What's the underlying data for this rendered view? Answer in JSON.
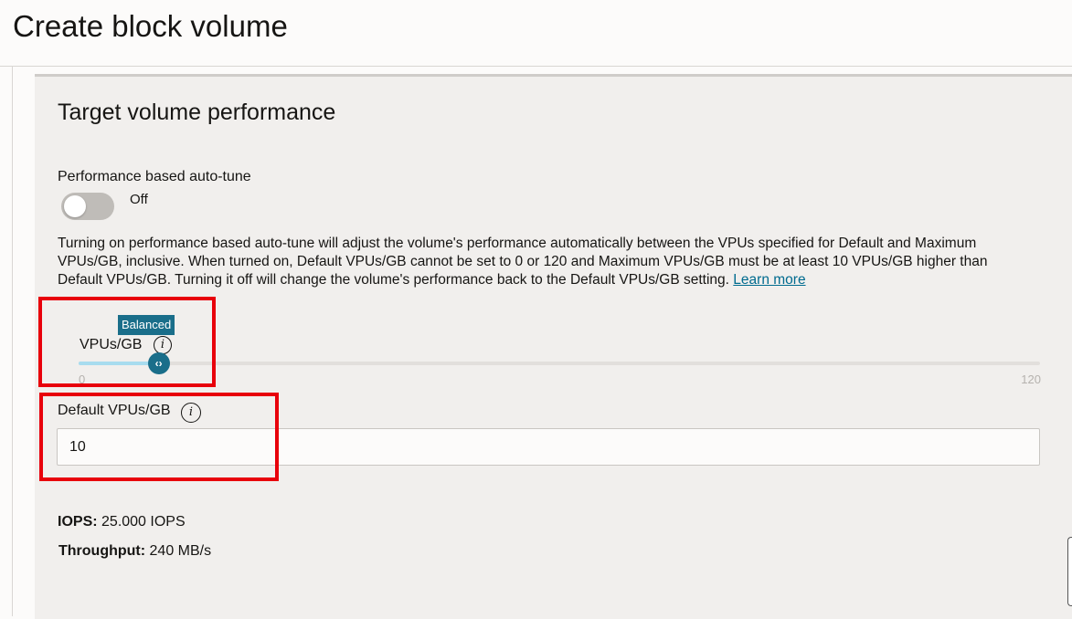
{
  "header": {
    "title": "Create block volume"
  },
  "section": {
    "title": "Target volume performance",
    "autotune": {
      "label": "Performance based auto-tune",
      "state": "Off",
      "enabled": false
    },
    "description": "Turning on performance based auto-tune will adjust the volume's performance automatically between the VPUs specified for Default and Maximum VPUs/GB, inclusive. When turned on, Default VPUs/GB cannot be set to 0 or 120 and Maximum VPUs/GB must be at least 10 VPUs/GB higher than Default VPUs/GB. Turning it off will change the volume's performance back to the Default VPUs/GB setting.",
    "learn_more": "Learn more",
    "slider": {
      "badge": "Balanced",
      "label": "VPUs/GB",
      "min_label": "0",
      "max_label": "120",
      "min": 0,
      "max": 120,
      "value": 10,
      "handle_glyph": "‹›"
    },
    "default_vpus": {
      "label": "Default VPUs/GB",
      "value": "10"
    },
    "metrics": {
      "iops_label": "IOPS:",
      "iops_value": "25.000 IOPS",
      "throughput_label": "Throughput:",
      "throughput_value": "240 MB/s"
    }
  },
  "icons": {
    "info": "i"
  },
  "colors": {
    "accent": "#1a6e8a",
    "link": "#006b8f",
    "highlight": "#e8000b",
    "slider_fill": "#a8dcef"
  }
}
